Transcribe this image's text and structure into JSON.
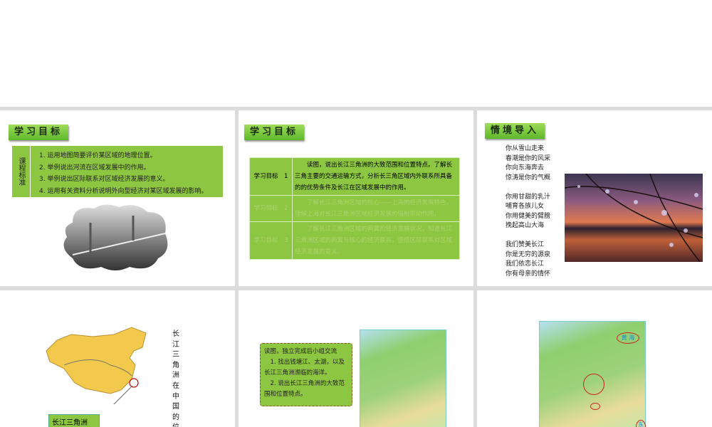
{
  "slide1": {
    "tag": "学习目标",
    "header": "课程标准",
    "items": [
      "1. 运用地图简要评价某区域的地理位置。",
      "2. 举例说出河流在区域发展中的作用。",
      "3. 举例说出区际联系对区域经济发展的意义。",
      "4. 运用有关资料分析说明外向型经济对某区域发展的影响。"
    ]
  },
  "slide2": {
    "tag": "学习目标",
    "rows": [
      {
        "label": "学习目标　1",
        "text": "读图，说出长江三角洲的大致范围和位置特点。了解长三角主要的交通运输方式，分析长三角区域内外联系所具备的的优势条件及长江在区域发展中的作用。"
      },
      {
        "label": "学习目标　2",
        "text": "了解长江三角洲区域的核心——上海的经济发展特色，理解上海对长江三角洲区域经济发展的辐射带动作用。"
      },
      {
        "label": "学习目标　3",
        "text": "了解长江三角洲区域的两翼的经济发展状况，知道长江三角洲区域的两翼与核心的经济联系，感悟区际联系对区域经济发展的意义。"
      }
    ]
  },
  "slide3": {
    "tag": "情境导入",
    "poem": [
      [
        "你从雪山走来",
        "春潮是你的风采",
        "你向东海奔去",
        "惊涛是你的气概"
      ],
      [
        "你用甘甜的乳汁",
        "哺育各族儿女",
        "你用健美的臂膀",
        "挽起高山大海"
      ],
      [
        "我们赞美长江",
        "你是无穷的源泉",
        "我们依恋长江",
        "你有母亲的情怀"
      ]
    ]
  },
  "slide4": {
    "vertical_text": "长江三角洲在中国的位置",
    "label": "长江三角洲"
  },
  "slide5": {
    "task": [
      "读图，独立完成后小组交流",
      "1. 找出钱塘江、太湖，以及长江三角洲濒临的海洋。",
      "2. 说出长江三角洲的大致范围和位置特点。"
    ]
  },
  "slide6": {
    "sea_label": "黄 海",
    "sea2": "东"
  }
}
